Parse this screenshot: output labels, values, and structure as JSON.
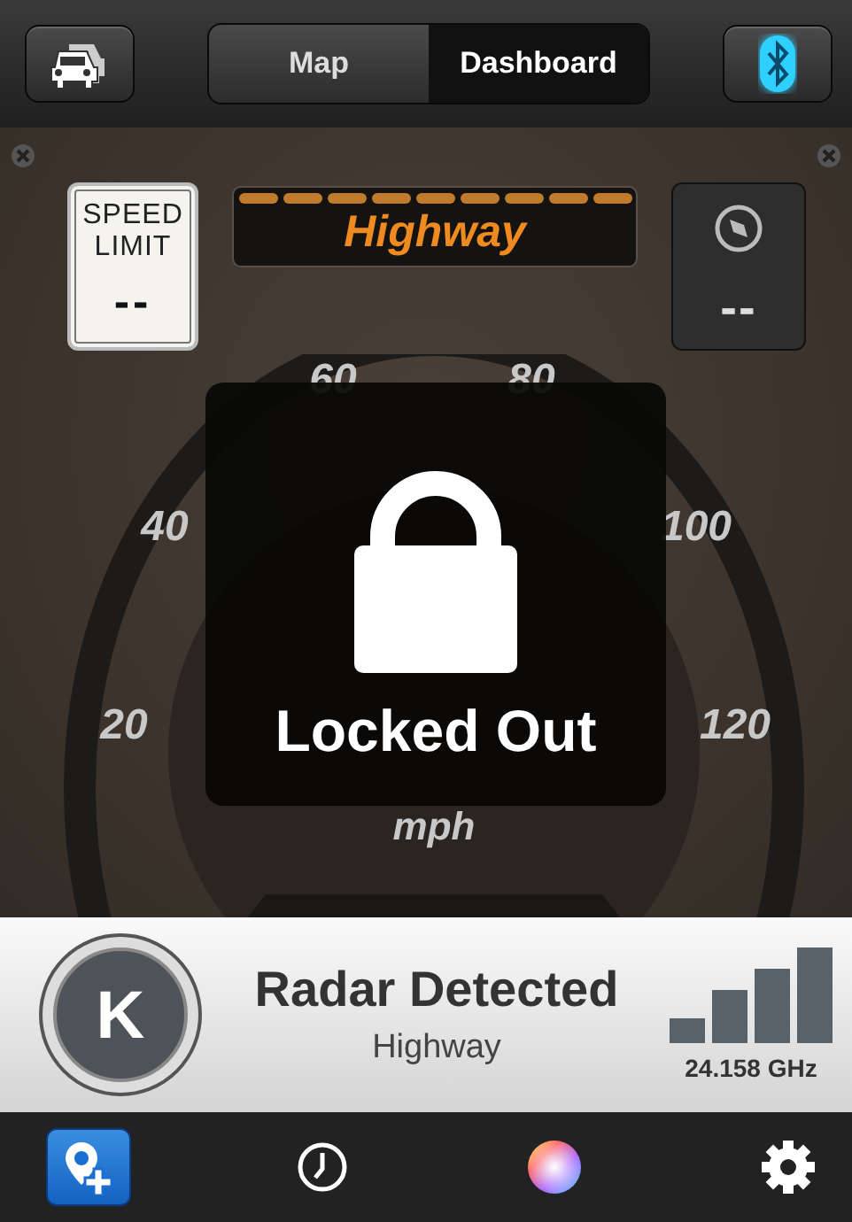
{
  "top_bar": {
    "tabs": [
      {
        "label": "Map",
        "selected": false
      },
      {
        "label": "Dashboard",
        "selected": true
      }
    ],
    "bluetooth": {
      "on": true
    }
  },
  "dashboard": {
    "speed_limit": {
      "line_1": "SPEED",
      "line_2": "LIMIT",
      "value": "--"
    },
    "road_type": {
      "label": "Highway"
    },
    "heading": {
      "value": "--"
    },
    "gauge": {
      "ticks": [
        "20",
        "40",
        "60",
        "80",
        "100",
        "120"
      ],
      "unit": "mph"
    },
    "lock": {
      "label": "Locked Out"
    }
  },
  "alert": {
    "band": "K",
    "title": "Radar Detected",
    "subtitle": "Highway",
    "frequency": "24.158 GHz"
  },
  "toolbar": {
    "items": [
      {
        "kind": "add-location",
        "selected": true
      },
      {
        "kind": "history",
        "selected": false
      },
      {
        "kind": "color",
        "selected": false
      },
      {
        "kind": "settings",
        "selected": false
      }
    ]
  }
}
